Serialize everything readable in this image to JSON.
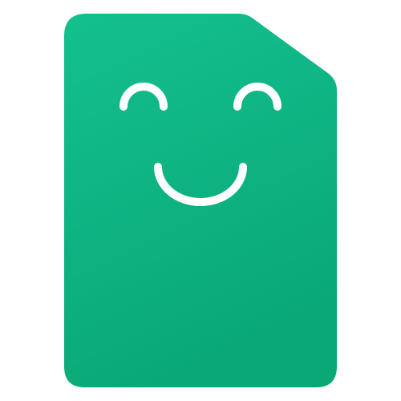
{
  "app_icon": {
    "name": "smiling-document-logo",
    "colors": {
      "background": "#ffffff",
      "body_top": "#14c08f",
      "body_bottom": "#0aa877",
      "face": "#ffffff"
    },
    "icon_names": {
      "body": "document-icon",
      "left_eye": "left-eye-icon",
      "right_eye": "right-eye-icon",
      "mouth": "smile-mouth-icon"
    }
  }
}
